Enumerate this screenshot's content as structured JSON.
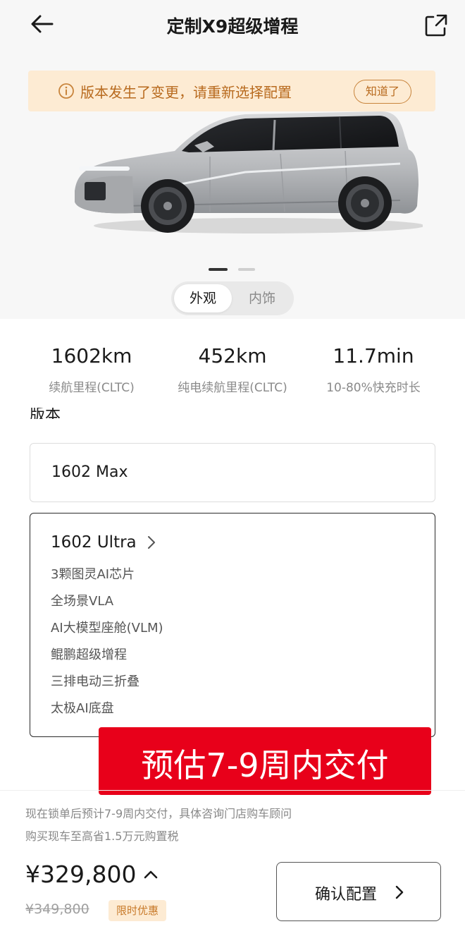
{
  "header": {
    "title": "定制X9超级增程",
    "back_icon": "arrow-left-icon",
    "share_icon": "share-icon"
  },
  "notice": {
    "text": "版本发生了变更，请重新选择配置",
    "button_label": "知道了",
    "icon": "info-circle-icon",
    "color": "#b86a1e",
    "background": "#fdebd3"
  },
  "gallery": {
    "total_slides": 2,
    "active_slide": 1
  },
  "view_tabs": [
    {
      "label": "外观",
      "active": true
    },
    {
      "label": "内饰",
      "active": false
    }
  ],
  "stats": [
    {
      "value": "1602km",
      "label": "续航里程(CLTC)"
    },
    {
      "value": "452km",
      "label": "纯电续航里程(CLTC)"
    },
    {
      "value": "11.7min",
      "label": "10-80%快充时长"
    }
  ],
  "section": {
    "label": "版本"
  },
  "options": [
    {
      "name": "1602 Max",
      "selected": false
    },
    {
      "name": "1602 Ultra",
      "selected": true,
      "features": [
        "3颗图灵AI芯片",
        "全场景VLA",
        "AI大模型座舱(VLM)",
        "鲲鹏超级增程",
        "三排电动三折叠",
        "太极AI底盘"
      ]
    }
  ],
  "overlay": {
    "text": "预估7-9周内交付",
    "background": "#e8001a"
  },
  "delivery_notes": [
    "现在锁单后预计7-9周内交付，具体咨询门店购车顾问",
    "购买现车至高省1.5万元购置税"
  ],
  "pricing": {
    "price": "¥329,800",
    "original_price": "¥349,800",
    "promo_label": "限时优惠",
    "toggle_icon": "chevron-up-icon"
  },
  "confirm": {
    "label": "确认配置"
  }
}
